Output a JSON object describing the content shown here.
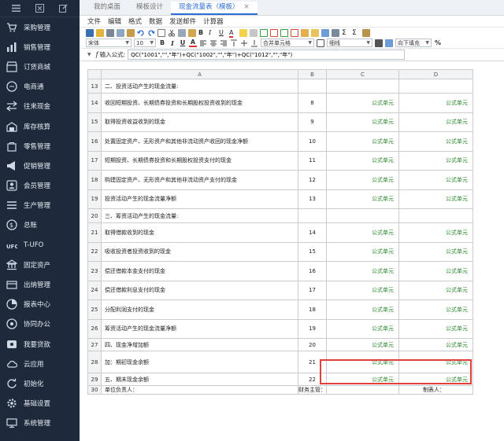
{
  "sidebar": {
    "items": [
      {
        "label": "采购管理",
        "icon": "cart-icon"
      },
      {
        "label": "销售管理",
        "icon": "bar-chart-icon"
      },
      {
        "label": "订货商城",
        "icon": "store-icon"
      },
      {
        "label": "电商通",
        "icon": "ecommerce-icon"
      },
      {
        "label": "往来现金",
        "icon": "cash-icon"
      },
      {
        "label": "库存核算",
        "icon": "warehouse-icon"
      },
      {
        "label": "零售管理",
        "icon": "retail-icon"
      },
      {
        "label": "促销管理",
        "icon": "megaphone-icon"
      },
      {
        "label": "会员管理",
        "icon": "member-icon"
      },
      {
        "label": "生产管理",
        "icon": "production-icon"
      },
      {
        "label": "总账",
        "icon": "ledger-icon"
      },
      {
        "label": "T-UFO",
        "icon": "ufo-icon"
      },
      {
        "label": "固定资产",
        "icon": "bank-icon"
      },
      {
        "label": "出纳管理",
        "icon": "cashier-icon"
      },
      {
        "label": "报表中心",
        "icon": "report-icon"
      },
      {
        "label": "协同办公",
        "icon": "collab-icon"
      },
      {
        "label": "我要贷款",
        "icon": "loan-icon"
      },
      {
        "label": "云应用",
        "icon": "cloud-icon"
      },
      {
        "label": "初始化",
        "icon": "init-icon"
      },
      {
        "label": "基础设置",
        "icon": "settings-icon"
      },
      {
        "label": "系统管理",
        "icon": "system-icon"
      }
    ]
  },
  "tabs": [
    {
      "label": "我的桌面",
      "active": false
    },
    {
      "label": "模板设计",
      "active": false
    },
    {
      "label": "现金流量表（模板）",
      "active": true,
      "close": "×"
    }
  ],
  "menu": [
    "文件",
    "编辑",
    "格式",
    "数据",
    "发送邮件",
    "计算器"
  ],
  "toolbar2": {
    "font": "宋体",
    "size": "10",
    "merge": "合并单元格",
    "border": "细线",
    "fill": "向下填充",
    "percent": "%"
  },
  "formula": {
    "label": "输入公式:",
    "value": "QC(\"1001\",\"\",\"年\")+QC(\"1002\",\"\",\"年\")+QC(\"1012\",\"\",\"年\")"
  },
  "columns": [
    "",
    "A",
    "B",
    "C",
    "D"
  ],
  "rows": [
    {
      "num": "13",
      "a": "二、投资活动产生的现金流量:",
      "indent": 0,
      "b": "",
      "c": "",
      "d": ""
    },
    {
      "num": "14",
      "a": "收回短期投资、长期债券投资和长期股权投资收到的现金",
      "indent": 1,
      "b": "8",
      "c": "公式单元",
      "d": "公式单元"
    },
    {
      "num": "15",
      "a": "取得投资收益收到的现金",
      "indent": 1,
      "b": "9",
      "c": "公式单元",
      "d": "公式单元"
    },
    {
      "num": "16",
      "a": "处置固定资产、无形资产和其他非流动资产收回的现金净额",
      "indent": 1,
      "b": "10",
      "c": "公式单元",
      "d": "公式单元"
    },
    {
      "num": "17",
      "a": "短期投资、长期债券投资和长期股权投资支付的现金",
      "indent": 1,
      "b": "11",
      "c": "公式单元",
      "d": "公式单元"
    },
    {
      "num": "18",
      "a": "购建固定资产、无形资产和其他非流动资产支付的现金",
      "indent": 1,
      "b": "12",
      "c": "公式单元",
      "d": "公式单元"
    },
    {
      "num": "19",
      "a": "投资活动产生的现金流量净额",
      "indent": 3,
      "b": "13",
      "c": "公式单元",
      "d": "公式单元"
    },
    {
      "num": "20",
      "a": "三、筹资活动产生的现金流量:",
      "indent": 0,
      "b": "",
      "c": "",
      "d": ""
    },
    {
      "num": "21",
      "a": "取得借款收到的现金",
      "indent": 1,
      "b": "14",
      "c": "公式单元",
      "d": "公式单元"
    },
    {
      "num": "22",
      "a": "吸收投资者投资收到的现金",
      "indent": 1,
      "b": "15",
      "c": "公式单元",
      "d": "公式单元"
    },
    {
      "num": "23",
      "a": "偿还借款本金支付的现金",
      "indent": 1,
      "b": "16",
      "c": "公式单元",
      "d": "公式单元"
    },
    {
      "num": "24",
      "a": "偿还借款利息支付的现金",
      "indent": 1,
      "b": "17",
      "c": "公式单元",
      "d": "公式单元"
    },
    {
      "num": "25",
      "a": "分配利润支付的现金",
      "indent": 1,
      "b": "18",
      "c": "公式单元",
      "d": "公式单元"
    },
    {
      "num": "26",
      "a": "筹资活动产生的现金流量净额",
      "indent": 3,
      "b": "19",
      "c": "公式单元",
      "d": "公式单元"
    },
    {
      "num": "27",
      "a": "四、现金净增加额",
      "indent": 0,
      "b": "20",
      "c": "公式单元",
      "d": "公式单元"
    },
    {
      "num": "28",
      "a": "加：期初现金余额",
      "indent": 0,
      "b": "21",
      "c": "公式单元",
      "d": "公式单元"
    },
    {
      "num": "29",
      "a": "五、期末现金余额",
      "indent": 0,
      "b": "22",
      "c": "公式单元",
      "d": "公式单元"
    },
    {
      "num": "30",
      "a": "单位负责人：",
      "indent": 0,
      "b": "财务主管：",
      "c": "",
      "d": "制表人："
    }
  ],
  "colors": {
    "sidebar": "#1e2a3b",
    "accent": "#2b6fd6",
    "formula_cell": "#2e8b2e",
    "highlight": "#e0413a"
  }
}
